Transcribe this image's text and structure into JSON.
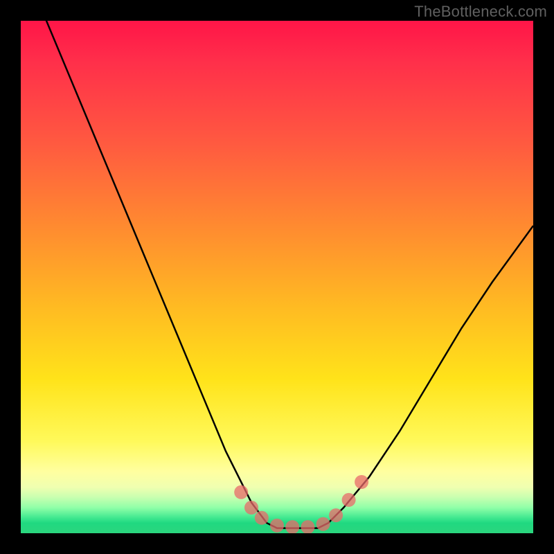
{
  "watermark": "TheBottleneck.com",
  "chart_data": {
    "type": "line",
    "title": "",
    "xlabel": "",
    "ylabel": "",
    "xlim": [
      0,
      1
    ],
    "ylim": [
      0,
      1
    ],
    "series": [
      {
        "name": "bottleneck-curve",
        "x": [
          0.0,
          0.05,
          0.1,
          0.15,
          0.2,
          0.25,
          0.3,
          0.35,
          0.4,
          0.45,
          0.48,
          0.5,
          0.52,
          0.55,
          0.58,
          0.6,
          0.63,
          0.68,
          0.74,
          0.8,
          0.86,
          0.92,
          1.0
        ],
        "values": [
          1.1,
          1.0,
          0.88,
          0.76,
          0.64,
          0.52,
          0.4,
          0.28,
          0.16,
          0.06,
          0.02,
          0.01,
          0.01,
          0.01,
          0.01,
          0.02,
          0.05,
          0.11,
          0.2,
          0.3,
          0.4,
          0.49,
          0.6
        ]
      }
    ],
    "markers": {
      "name": "highlight-points",
      "x": [
        0.43,
        0.45,
        0.47,
        0.5,
        0.53,
        0.56,
        0.59,
        0.615,
        0.64,
        0.665
      ],
      "values": [
        0.08,
        0.05,
        0.03,
        0.015,
        0.012,
        0.012,
        0.018,
        0.035,
        0.065,
        0.1
      ]
    },
    "background_gradient_stops": [
      {
        "pos": 0.0,
        "color": "#ff1548"
      },
      {
        "pos": 0.24,
        "color": "#ff5a40"
      },
      {
        "pos": 0.56,
        "color": "#ffbb22"
      },
      {
        "pos": 0.82,
        "color": "#fff95a"
      },
      {
        "pos": 0.95,
        "color": "#90ffa8"
      },
      {
        "pos": 1.0,
        "color": "#2bd67e"
      }
    ]
  }
}
